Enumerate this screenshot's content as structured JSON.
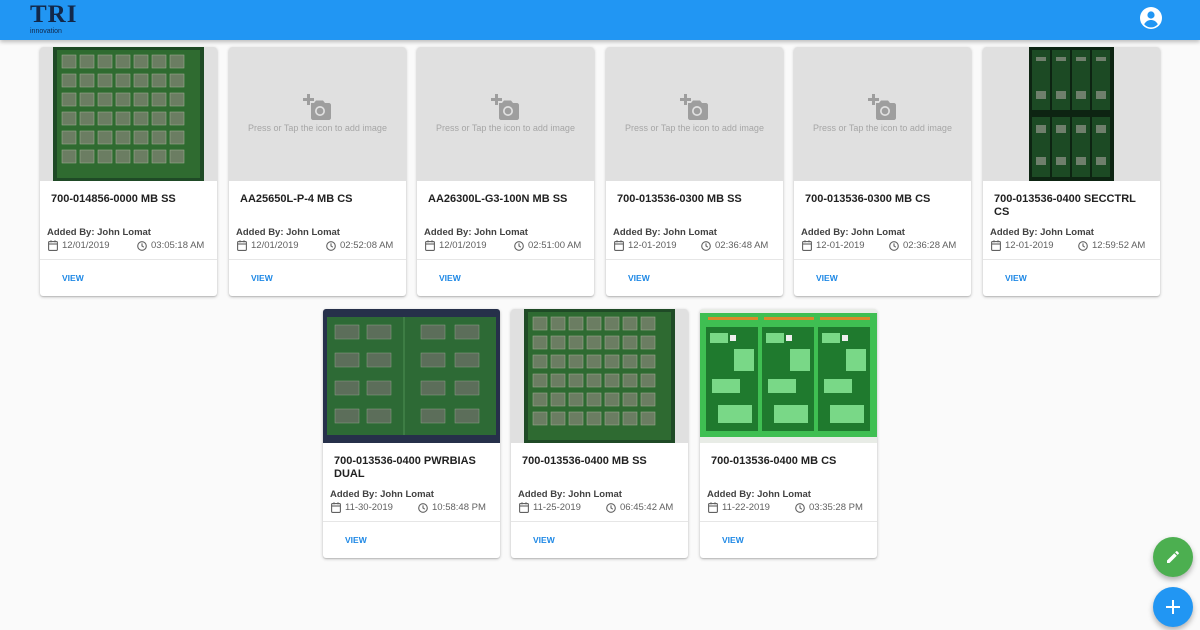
{
  "app": {
    "logo_main": "TRI",
    "logo_sub": "innovation",
    "account_icon": "account-circle-icon",
    "brand_color": "#2196f3",
    "accent_green": "#4caf50"
  },
  "placeholder_hint": "Press or Tap the icon to add image",
  "cards": [
    {
      "title": "700-014856-0000 MB SS",
      "added_by": "Added By: John Lomat",
      "date": "12/01/2019",
      "time": "03:05:18 AM",
      "view_label": "VIEW",
      "image": "pcb-photo"
    },
    {
      "title": "AA25650L-P-4 MB CS",
      "added_by": "Added By: John Lomat",
      "date": "12/01/2019",
      "time": "02:52:08 AM",
      "view_label": "VIEW",
      "image": "none"
    },
    {
      "title": "AA26300L-G3-100N MB SS",
      "added_by": "Added By: John Lomat",
      "date": "12/01/2019",
      "time": "02:51:00 AM",
      "view_label": "VIEW",
      "image": "none"
    },
    {
      "title": "700-013536-0300 MB SS",
      "added_by": "Added By: John Lomat",
      "date": "12-01-2019",
      "time": "02:36:48 AM",
      "view_label": "VIEW",
      "image": "none"
    },
    {
      "title": "700-013536-0300 MB CS",
      "added_by": "Added By: John Lomat",
      "date": "12-01-2019",
      "time": "02:36:28 AM",
      "view_label": "VIEW",
      "image": "none"
    },
    {
      "title": "700-013536-0400 SECCTRL CS",
      "added_by": "Added By: John Lomat",
      "date": "12-01-2019",
      "time": "12:59:52 AM",
      "view_label": "VIEW",
      "image": "pcb-photo"
    },
    {
      "title": "700-013536-0400 PWRBIAS DUAL",
      "added_by": "Added By: John Lomat",
      "date": "11-30-2019",
      "time": "10:58:48 PM",
      "view_label": "VIEW",
      "image": "pcb-photo"
    },
    {
      "title": "700-013536-0400 MB SS",
      "added_by": "Added By: John Lomat",
      "date": "11-25-2019",
      "time": "06:45:42 AM",
      "view_label": "VIEW",
      "image": "pcb-photo"
    },
    {
      "title": "700-013536-0400 MB CS",
      "added_by": "Added By: John Lomat",
      "date": "11-22-2019",
      "time": "03:35:28 PM",
      "view_label": "VIEW",
      "image": "pcb-photo"
    }
  ],
  "fabs": {
    "edit_icon": "pencil-icon",
    "add_icon": "plus-icon"
  }
}
